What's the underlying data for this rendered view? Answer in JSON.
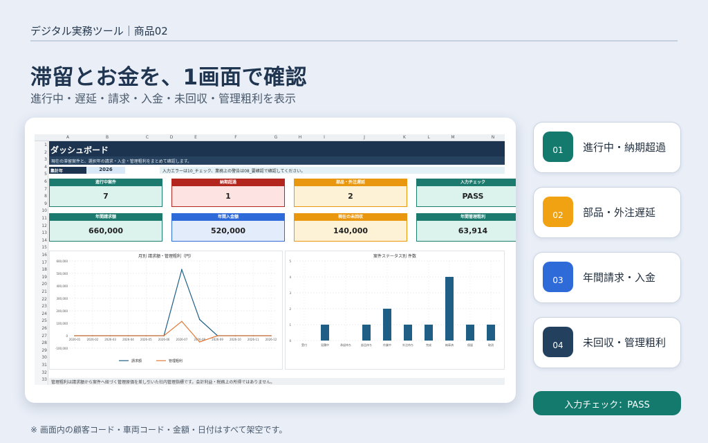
{
  "header": {
    "brand": "デジタル実務ツール｜商品02",
    "headline": "滞留とお金を、1画面で確認",
    "subline": "進行中・遅延・請求・入金・未回収・管理粗利を表示"
  },
  "sheet": {
    "columns": [
      "A",
      "B",
      "C",
      "D",
      "E",
      "F",
      "G",
      "H",
      "I",
      "J",
      "K",
      "L",
      "M",
      "N"
    ],
    "rows": [
      "1",
      "2",
      "3",
      "4",
      "5",
      "6",
      "7",
      "8",
      "9",
      "10",
      "11",
      "12",
      "13",
      "14",
      "15",
      "16",
      "17",
      "18",
      "19",
      "20",
      "21",
      "22",
      "23",
      "24",
      "25",
      "26",
      "27",
      "28",
      "29",
      "30",
      "31",
      "32",
      "33"
    ],
    "title": "ダッシュボード",
    "note": "現在の滞留案件と、選択年の請求・入金・管理粗利をまとめて確認します。",
    "year_label": "集計年",
    "year_value": "2026",
    "year_note": "入力エラーは10_チェック、業務上の警告は08_要確認で確認してください。",
    "kpis_row1": [
      {
        "label": "進行中案件",
        "value": "7",
        "color": "#1c7a6e"
      },
      {
        "label": "納期超過",
        "value": "1",
        "color": "#b3261e"
      },
      {
        "label": "部品・外注遅延",
        "value": "2",
        "color": "#e8970f"
      },
      {
        "label": "入力チェック",
        "value": "PASS",
        "color": "#1c7a6e"
      }
    ],
    "kpis_row2": [
      {
        "label": "年間請求額",
        "value": "660,000",
        "color": "#1c7a6e"
      },
      {
        "label": "年間入金額",
        "value": "520,000",
        "color": "#2f6ad9"
      },
      {
        "label": "現在の未回収",
        "value": "140,000",
        "color": "#e8970f"
      },
      {
        "label": "年間管理粗利",
        "value": "63,914",
        "color": "#1c7a6e"
      }
    ],
    "footnote": "管理粗利は請求額から案件へ紐づく管理原価を差し引いた社内管理指標です。会計利益・税務上の所得ではありません。"
  },
  "chart_data": [
    {
      "type": "line",
      "title": "月別 請求額・管理粗利（円）",
      "x": [
        "2026-01",
        "2026-02",
        "2026-03",
        "2026-04",
        "2026-05",
        "2026-06",
        "2026-07",
        "2026-08",
        "2026-09",
        "2026-10",
        "2026-11",
        "2026-12"
      ],
      "yticks": [
        "600,000",
        "500,000",
        "400,000",
        "300,000",
        "200,000",
        "100,000",
        "0",
        "-100,000"
      ],
      "ylim": [
        -100000,
        600000
      ],
      "series": [
        {
          "name": "請求額",
          "color": "#1f5f86",
          "values": [
            0,
            0,
            0,
            0,
            0,
            0,
            530000,
            130000,
            0,
            0,
            0,
            0
          ]
        },
        {
          "name": "管理粗利",
          "color": "#e07b39",
          "values": [
            0,
            0,
            0,
            0,
            0,
            0,
            115000,
            -50000,
            0,
            0,
            0,
            0
          ]
        }
      ],
      "grid": true,
      "legend": "bottom"
    },
    {
      "type": "bar",
      "title": "案件ステータス別 件数",
      "categories": [
        "受付",
        "見積中",
        "承認待ち",
        "部品待ち",
        "作業中",
        "外注待ち",
        "完成",
        "納車済",
        "保留",
        "取消"
      ],
      "yticks": [
        "5",
        "4",
        "3",
        "2",
        "1",
        "0"
      ],
      "ylim": [
        0,
        5
      ],
      "values": [
        0,
        1,
        0,
        1,
        2,
        1,
        1,
        4,
        1,
        1
      ],
      "color": "#1f5f86",
      "grid": true
    }
  ],
  "features": [
    {
      "num": "01",
      "label": "進行中・納期超過",
      "color": "#147a6e"
    },
    {
      "num": "02",
      "label": "部品・外注遅延",
      "color": "#f0a213"
    },
    {
      "num": "03",
      "label": "年間請求・入金",
      "color": "#2f6ad9"
    },
    {
      "num": "04",
      "label": "未回収・管理粗利",
      "color": "#23405f"
    }
  ],
  "pass_button": "入力チェック：PASS",
  "footer": "※ 画面内の顧客コード・車両コード・金額・日付はすべて架空です。"
}
